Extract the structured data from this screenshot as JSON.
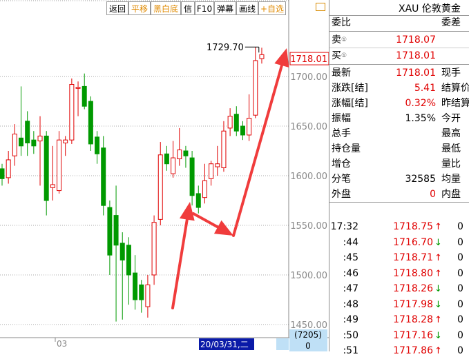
{
  "toolbar": {
    "buttons": [
      "返回",
      "平移",
      "黑白底",
      "信",
      "F10",
      "弹幕",
      "画线",
      "+自选"
    ]
  },
  "chart_data": {
    "type": "candlestick",
    "y_ticks": [
      "1700.00",
      "1650.00",
      "1600.00",
      "1550.00",
      "1500.00",
      "1450.00"
    ],
    "ylim": [
      1437,
      1750
    ],
    "x_label": "03",
    "cursor_date": "20/03/31,二",
    "volume_label": "(7205)",
    "volume_value": "0",
    "high_annotation": "1729.70",
    "last_price_label": "1718.01",
    "candles": [
      {
        "o": 1607,
        "c": 1597,
        "h": 1612,
        "l": 1590
      },
      {
        "o": 1598,
        "c": 1616,
        "h": 1625,
        "l": 1592
      },
      {
        "o": 1620,
        "c": 1642,
        "h": 1652,
        "l": 1610
      },
      {
        "o": 1638,
        "c": 1630,
        "h": 1690,
        "l": 1620
      },
      {
        "o": 1655,
        "c": 1633,
        "h": 1665,
        "l": 1620
      },
      {
        "o": 1636,
        "c": 1630,
        "h": 1645,
        "l": 1622
      },
      {
        "o": 1635,
        "c": 1640,
        "h": 1660,
        "l": 1590
      },
      {
        "o": 1640,
        "c": 1575,
        "h": 1645,
        "l": 1560
      },
      {
        "o": 1588,
        "c": 1591,
        "h": 1630,
        "l": 1575
      },
      {
        "o": 1585,
        "c": 1636,
        "h": 1645,
        "l": 1582
      },
      {
        "o": 1633,
        "c": 1636,
        "h": 1640,
        "l": 1620
      },
      {
        "o": 1636,
        "c": 1692,
        "h": 1698,
        "l": 1632
      },
      {
        "o": 1688,
        "c": 1689,
        "h": 1695,
        "l": 1660
      },
      {
        "o": 1690,
        "c": 1670,
        "h": 1703,
        "l": 1667
      },
      {
        "o": 1675,
        "c": 1632,
        "h": 1680,
        "l": 1625
      },
      {
        "o": 1639,
        "c": 1622,
        "h": 1645,
        "l": 1612
      },
      {
        "o": 1628,
        "c": 1570,
        "h": 1640,
        "l": 1560
      },
      {
        "o": 1568,
        "c": 1520,
        "h": 1575,
        "l": 1500
      },
      {
        "o": 1560,
        "c": 1530,
        "h": 1590,
        "l": 1453
      },
      {
        "o": 1532,
        "c": 1515,
        "h": 1543,
        "l": 1455
      },
      {
        "o": 1530,
        "c": 1500,
        "h": 1538,
        "l": 1470
      },
      {
        "o": 1502,
        "c": 1475,
        "h": 1520,
        "l": 1465
      },
      {
        "o": 1490,
        "c": 1475,
        "h": 1495,
        "l": 1462
      },
      {
        "o": 1468,
        "c": 1490,
        "h": 1500,
        "l": 1457
      },
      {
        "o": 1500,
        "c": 1553,
        "h": 1560,
        "l": 1490
      },
      {
        "o": 1556,
        "c": 1621,
        "h": 1634,
        "l": 1550
      },
      {
        "o": 1622,
        "c": 1612,
        "h": 1630,
        "l": 1605
      },
      {
        "o": 1602,
        "c": 1618,
        "h": 1635,
        "l": 1598
      },
      {
        "o": 1617,
        "c": 1626,
        "h": 1648,
        "l": 1610
      },
      {
        "o": 1625,
        "c": 1620,
        "h": 1630,
        "l": 1608
      },
      {
        "o": 1618,
        "c": 1580,
        "h": 1625,
        "l": 1570
      },
      {
        "o": 1582,
        "c": 1568,
        "h": 1590,
        "l": 1562
      },
      {
        "o": 1578,
        "c": 1595,
        "h": 1612,
        "l": 1572
      },
      {
        "o": 1597,
        "c": 1612,
        "h": 1615,
        "l": 1590
      },
      {
        "o": 1609,
        "c": 1612,
        "h": 1630,
        "l": 1600
      },
      {
        "o": 1608,
        "c": 1645,
        "h": 1655,
        "l": 1604
      },
      {
        "o": 1648,
        "c": 1660,
        "h": 1668,
        "l": 1640
      },
      {
        "o": 1662,
        "c": 1645,
        "h": 1670,
        "l": 1640
      },
      {
        "o": 1650,
        "c": 1641,
        "h": 1655,
        "l": 1636
      },
      {
        "o": 1641,
        "c": 1658,
        "h": 1682,
        "l": 1635
      },
      {
        "o": 1661,
        "c": 1716,
        "h": 1729.7,
        "l": 1658
      },
      {
        "o": 1718,
        "c": 1722,
        "h": 1729,
        "l": 1713
      }
    ]
  },
  "panel": {
    "title": "XAU 伦敦黄金",
    "header_left": "委比",
    "header_right": "委差",
    "sell_label": "卖",
    "sell_value": "1718.07",
    "buy_label": "买",
    "buy_value": "1718.01",
    "stats": [
      {
        "l": "最新",
        "v": "1718.01",
        "c": "red",
        "r": "现手"
      },
      {
        "l": "涨跌[结]",
        "v": "5.41",
        "c": "red",
        "r": "结算价"
      },
      {
        "l": "涨幅[结]",
        "v": "0.32%",
        "c": "red",
        "r": "昨结算"
      },
      {
        "l": "振幅",
        "v": "1.35%",
        "c": "black",
        "r": "今开"
      },
      {
        "l": "总手",
        "v": "",
        "c": "black",
        "r": "最高"
      },
      {
        "l": "持仓量",
        "v": "",
        "c": "black",
        "r": "最低"
      },
      {
        "l": "增仓",
        "v": "",
        "c": "black",
        "r": "量比"
      },
      {
        "l": "分笔",
        "v": "32585",
        "c": "black",
        "r": "均量"
      },
      {
        "l": "外盘",
        "v": "0",
        "c": "red",
        "r": "内盘"
      }
    ],
    "ticks": [
      {
        "t": "17:32",
        "p": "1718.75",
        "d": "↑",
        "q": "0"
      },
      {
        "t": ":44",
        "p": "1716.70",
        "d": "↓",
        "q": "0"
      },
      {
        "t": ":45",
        "p": "1718.71",
        "d": "↑",
        "q": "0"
      },
      {
        "t": ":46",
        "p": "1718.80",
        "d": "↑",
        "q": "0"
      },
      {
        "t": ":47",
        "p": "1718.26",
        "d": "↓",
        "q": "0"
      },
      {
        "t": ":48",
        "p": "1717.98",
        "d": "↓",
        "q": "0"
      },
      {
        "t": ":49",
        "p": "1718.28",
        "d": "↑",
        "q": "0"
      },
      {
        "t": ":50",
        "p": "1717.16",
        "d": "↓",
        "q": "0"
      },
      {
        "t": ":51",
        "p": "1717.86",
        "d": "↑",
        "q": "0"
      }
    ]
  }
}
